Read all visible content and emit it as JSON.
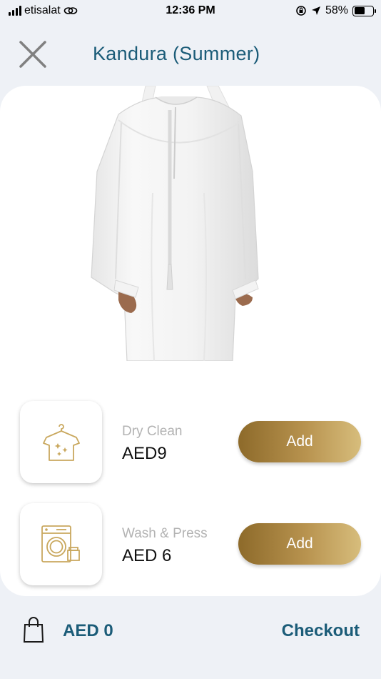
{
  "status_bar": {
    "carrier": "etisalat",
    "time": "12:36 PM",
    "battery": "58%",
    "battery_level": 0.58
  },
  "header": {
    "title": "Kandura (Summer)",
    "close_icon": "close-icon"
  },
  "product": {
    "image_icon": "kandura-garment-image"
  },
  "services": [
    {
      "name": "Dry Clean",
      "price": "AED9",
      "button_label": "Add",
      "icon": "shirt-sparkle-icon"
    },
    {
      "name": "Wash & Press",
      "price": "AED 6",
      "button_label": "Add",
      "icon": "washing-machine-icon"
    }
  ],
  "bottom_bar": {
    "cart_total": "AED 0",
    "checkout_label": "Checkout",
    "bag_icon": "shopping-bag-icon"
  },
  "colors": {
    "primary_text": "#1b5c78",
    "gold_dark": "#8d6a2a",
    "gold_light": "#d7bd7c",
    "background": "#eef1f6",
    "icon_gold": "#c9a85e"
  }
}
